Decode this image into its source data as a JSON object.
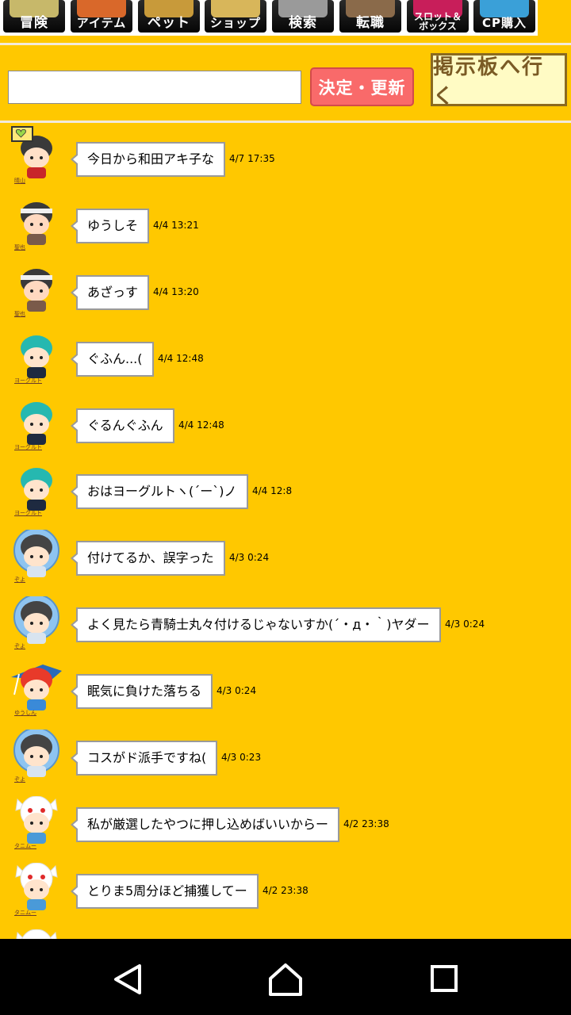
{
  "nav": {
    "items": [
      {
        "label": "冒険",
        "icon": "adventure-icon",
        "color": "#c7b86a",
        "size": "normal"
      },
      {
        "label": "アイテム",
        "icon": "item-icon",
        "color": "#d9682a",
        "size": "mid"
      },
      {
        "label": "ペット",
        "icon": "pet-icon",
        "color": "#c89a3a",
        "size": "normal"
      },
      {
        "label": "ショップ",
        "icon": "shop-icon",
        "color": "#d8b65a",
        "size": "mid"
      },
      {
        "label": "検索",
        "icon": "search-icon",
        "color": "#9a9a9a",
        "size": "normal"
      },
      {
        "label": "転職",
        "icon": "job-change-icon",
        "color": "#8a6a4a",
        "size": "normal"
      },
      {
        "label": "スロット＆\nボックス",
        "icon": "slot-box-icon",
        "color": "#c81e5a",
        "size": "small"
      },
      {
        "label": "CP購入",
        "icon": "cp-icon",
        "color": "#3aa0d8",
        "size": "mid"
      }
    ]
  },
  "form": {
    "input_value": "",
    "submit_label": "決定・更新",
    "board_label": "掲示板へ行く"
  },
  "messages": [
    {
      "user": "晴山",
      "avatar": "dark-hair-red-shirt-avatar",
      "text": "今日から和田アキ子な",
      "time": "4/7 17:35",
      "badge": true
    },
    {
      "user": "聖也",
      "avatar": "dark-hair-bandana-avatar",
      "text": "ゆうしそ",
      "time": "4/4 13:21"
    },
    {
      "user": "聖也",
      "avatar": "dark-hair-bandana-avatar",
      "text": "あざっす",
      "time": "4/4 13:20"
    },
    {
      "user": "ヨーグルト",
      "avatar": "teal-hair-avatar",
      "text": "ぐふん...(",
      "time": "4/4 12:48"
    },
    {
      "user": "ヨーグルト",
      "avatar": "teal-hair-avatar",
      "text": "ぐるんぐふん",
      "time": "4/4 12:48"
    },
    {
      "user": "ヨーグルト",
      "avatar": "teal-hair-avatar",
      "text": "おはヨーグルトヽ(´ー`)ノ",
      "time": "4/4 12:8"
    },
    {
      "user": "ぞよ",
      "avatar": "blue-helmet-avatar",
      "text": "付けてるか、誤字った",
      "time": "4/3 0:24"
    },
    {
      "user": "ぞよ",
      "avatar": "blue-helmet-avatar",
      "text": "よく見たら青騎士丸々付けるじゃないすか(´・д・｀)ヤダー",
      "time": "4/3 0:24"
    },
    {
      "user": "ゆうしん",
      "avatar": "red-hair-feather-hat-avatar",
      "text": "眠気に負けた落ちる",
      "time": "4/3 0:24"
    },
    {
      "user": "ぞよ",
      "avatar": "blue-helmet-avatar",
      "text": "コスがド派手ですね(",
      "time": "4/3 0:23"
    },
    {
      "user": "タニムー",
      "avatar": "white-cat-hood-avatar",
      "text": "私が厳選したやつに押し込めばいいからー",
      "time": "4/2 23:38"
    },
    {
      "user": "タニムー",
      "avatar": "white-cat-hood-avatar",
      "text": "とりま5周分ほど捕獲してー",
      "time": "4/2 23:38"
    },
    {
      "user": "タニムー",
      "avatar": "white-cat-hood-avatar",
      "text": "",
      "time": ""
    }
  ],
  "system_nav": {
    "back": "back-icon",
    "home": "home-icon",
    "recents": "recents-icon"
  }
}
